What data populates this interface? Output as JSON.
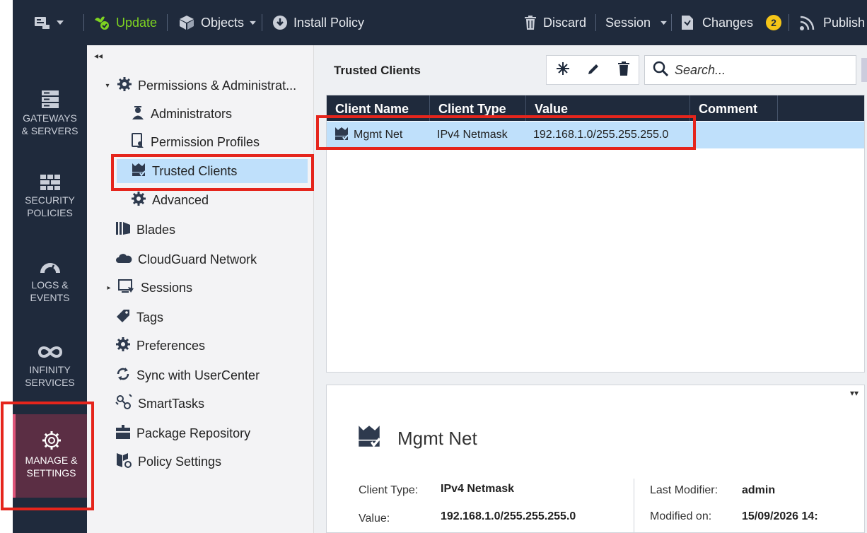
{
  "toolbar": {
    "update_label": "Update",
    "objects_label": "Objects",
    "install_policy_label": "Install Policy",
    "discard_label": "Discard",
    "session_label": "Session",
    "changes_label": "Changes",
    "changes_count": "2",
    "publish_label": "Publish"
  },
  "leftnav": {
    "items": [
      {
        "line1": "GATEWAYS",
        "line2": "& SERVERS"
      },
      {
        "line1": "SECURITY",
        "line2": "POLICIES"
      },
      {
        "line1": "LOGS &",
        "line2": "EVENTS"
      },
      {
        "line1": "INFINITY",
        "line2": "SERVICES"
      },
      {
        "line1": "MANAGE &",
        "line2": "SETTINGS"
      }
    ]
  },
  "tree": {
    "items": [
      {
        "label": "Permissions & Administrat..."
      },
      {
        "label": "Administrators"
      },
      {
        "label": "Permission Profiles"
      },
      {
        "label": "Trusted Clients"
      },
      {
        "label": "Advanced"
      },
      {
        "label": "Blades"
      },
      {
        "label": "CloudGuard Network"
      },
      {
        "label": "Sessions"
      },
      {
        "label": "Tags"
      },
      {
        "label": "Preferences"
      },
      {
        "label": "Sync with UserCenter"
      },
      {
        "label": "SmartTasks"
      },
      {
        "label": "Package Repository"
      },
      {
        "label": "Policy Settings"
      }
    ]
  },
  "content": {
    "title": "Trusted Clients",
    "search_placeholder": "Search...",
    "table": {
      "columns": [
        "Client Name",
        "Client Type",
        "Value",
        "Comment"
      ],
      "rows": [
        {
          "name": "Mgmt Net",
          "type": "IPv4 Netmask",
          "value": "192.168.1.0/255.255.255.0",
          "comment": ""
        }
      ]
    },
    "details": {
      "title": "Mgmt Net",
      "client_type_label": "Client Type:",
      "client_type_value": "IPv4 Netmask",
      "value_label": "Value:",
      "value_value": "192.168.1.0/255.255.255.0",
      "last_modifier_label": "Last Modifier:",
      "last_modifier_value": "admin",
      "modified_on_label": "Modified on:",
      "modified_on_value": "15/09/2026 14:"
    }
  },
  "colors": {
    "nav_bg": "#1f2a3c",
    "accent_green": "#7ed321",
    "selection_blue": "#bfe0fb",
    "highlight_red": "#e5251c",
    "active_nav_bg": "#5b2e44"
  }
}
